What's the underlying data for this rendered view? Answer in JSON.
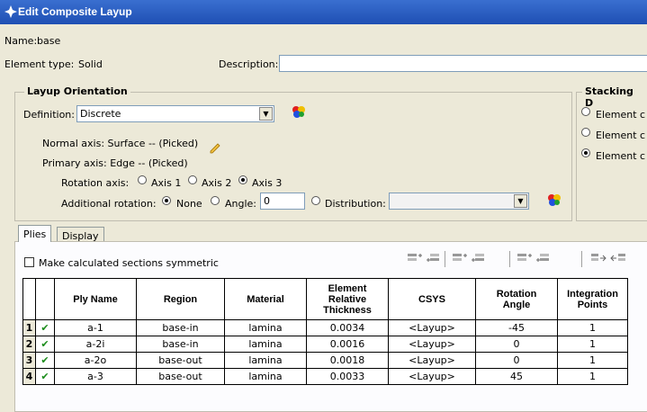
{
  "window": {
    "title": "Edit Composite Layup",
    "icon": "abaqus-app-icon"
  },
  "name_label": "Name:",
  "name_value": "base",
  "element_type_label": "Element type:",
  "element_type_value": "Solid",
  "description_label": "Description:",
  "description_value": "",
  "layup_orientation": {
    "title": "Layup Orientation",
    "definition_label": "Definition:",
    "definition_value": "Discrete",
    "normal_axis": "Normal axis: Surface -- (Picked)",
    "primary_axis": "Primary axis: Edge -- (Picked)",
    "rotation_axis_label": "Rotation axis:",
    "rotation_axes": [
      "Axis 1",
      "Axis 2",
      "Axis 3"
    ],
    "rotation_axis_selected": "Axis 3",
    "additional_rotation_label": "Additional rotation:",
    "none_label": "None",
    "angle_label": "Angle:",
    "angle_value": "0",
    "distribution_label": "Distribution:",
    "distribution_value": "",
    "additional_rotation_selected": "None"
  },
  "stacking": {
    "title": "Stacking D",
    "options": [
      "Element c",
      "Element c",
      "Element c"
    ],
    "selected_index": 2
  },
  "tabs": [
    {
      "label": "Plies",
      "active": true
    },
    {
      "label": "Display",
      "active": false
    }
  ],
  "symmetric_checkbox": {
    "label": "Make calculated sections symmetric",
    "checked": false
  },
  "toolbar_icons": [
    "insert-before-icon",
    "insert-after-icon",
    "add-before-icon",
    "add-after-icon",
    "copy-before-icon",
    "copy-after-icon",
    "move-right-icon",
    "move-left-icon"
  ],
  "table": {
    "headers": [
      "Ply Name",
      "Region",
      "Material",
      "Element\nRelative\nThickness",
      "CSYS",
      "Rotation\nAngle",
      "Integration\nPoints"
    ],
    "rows": [
      {
        "num": "1",
        "status": "✔",
        "ply": "a-1",
        "region": "base-in",
        "material": "lamina",
        "thickness": "0.0034",
        "csys": "<Layup>",
        "angle": "-45",
        "points": "1"
      },
      {
        "num": "2",
        "status": "✔",
        "ply": "a-2i",
        "region": "base-in",
        "material": "lamina",
        "thickness": "0.0016",
        "csys": "<Layup>",
        "angle": "0",
        "points": "1"
      },
      {
        "num": "3",
        "status": "✔",
        "ply": "a-2o",
        "region": "base-out",
        "material": "lamina",
        "thickness": "0.0018",
        "csys": "<Layup>",
        "angle": "0",
        "points": "1"
      },
      {
        "num": "4",
        "status": "✔",
        "ply": "a-3",
        "region": "base-out",
        "material": "lamina",
        "thickness": "0.0033",
        "csys": "<Layup>",
        "angle": "45",
        "points": "1"
      }
    ]
  },
  "colors": {
    "title_bar": "#2a5cc4",
    "check_green": "#1a8c1a",
    "dialog_bg": "#ece9d8"
  }
}
